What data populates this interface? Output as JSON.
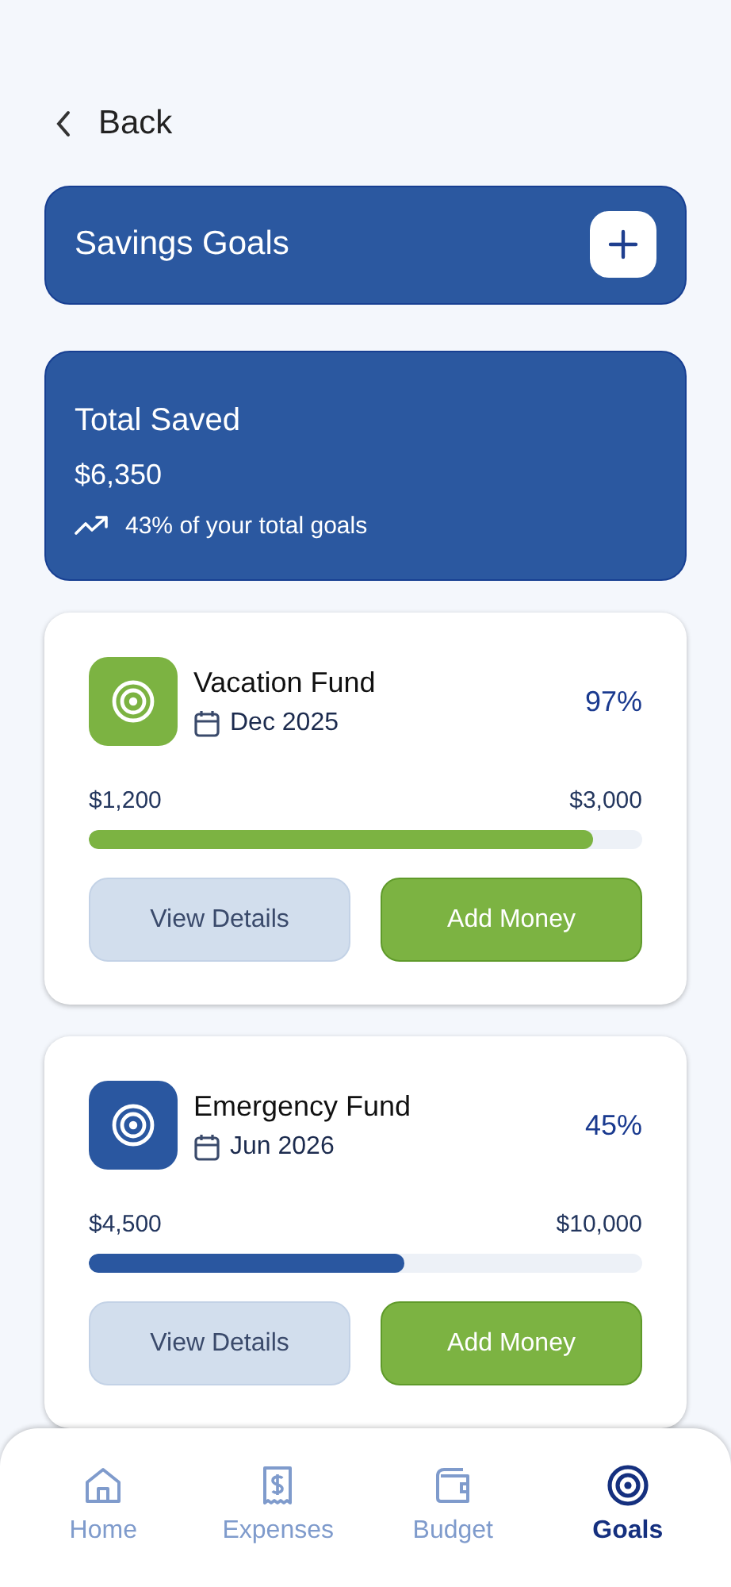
{
  "back": {
    "label": "Back"
  },
  "header": {
    "title": "Savings Goals"
  },
  "summary": {
    "title": "Total Saved",
    "amount": "$6,350",
    "note": "43% of your total goals"
  },
  "goals": [
    {
      "name": "Vacation Fund",
      "date": "Dec 2025",
      "percent": "97%",
      "saved": "$1,200",
      "target": "$3,000",
      "level": 0.91,
      "color": "#7cb342",
      "buttons": [
        "View Details",
        "Add Money"
      ]
    },
    {
      "name": "Emergency Fund",
      "date": "Jun 2026",
      "percent": "45%",
      "saved": "$4,500",
      "target": "$10,000",
      "level": 0.57,
      "color": "#2a57a0",
      "buttons": [
        "View Details",
        "Add Money"
      ]
    }
  ],
  "nav": [
    {
      "label": "Home",
      "kind": "home",
      "selected": false
    },
    {
      "label": "Expenses",
      "kind": "receipt",
      "selected": false
    },
    {
      "label": "Budget",
      "kind": "wallet",
      "selected": false
    },
    {
      "label": "Goals",
      "kind": "target",
      "selected": true
    }
  ]
}
